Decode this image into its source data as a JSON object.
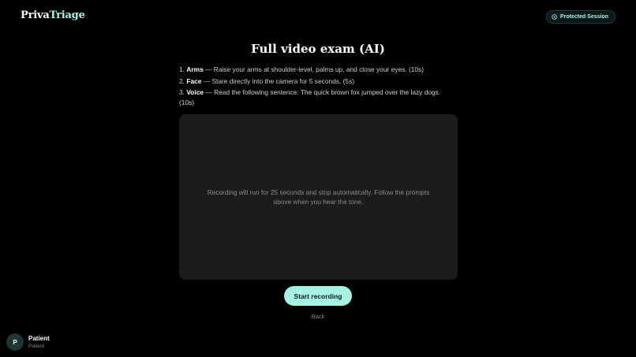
{
  "header": {
    "logo_primary": "Priva",
    "logo_accent": "Triage",
    "session_badge": "Protected Session"
  },
  "main": {
    "title": "Full video exam (AI)",
    "steps": [
      {
        "number": "1.",
        "name": "Arms",
        "text": " — Raise your arms at shoulder-level, palms up, and close your eyes. (10s)"
      },
      {
        "number": "2.",
        "name": "Face",
        "text": " — Stare directly into the camera for 5 seconds. (5s)"
      },
      {
        "number": "3.",
        "name": "Voice",
        "text": " — Read the following sentence: The quick brown fox jumped over the lazy dogs. (10s)"
      }
    ],
    "recorder_hint": "Recording will run for 25 seconds and stop automatically. Follow the prompts above when you hear the tone.",
    "start_button": "Start recording",
    "back_link": "Back"
  },
  "user": {
    "avatar_initial": "P",
    "name": "Patient",
    "role": "Patient"
  },
  "colors": {
    "background": "#000000",
    "accent": "#a6f2e3",
    "panel": "#1c1c1c",
    "muted_text": "#8a8a8a"
  },
  "icons": {
    "session": "shield-icon"
  }
}
